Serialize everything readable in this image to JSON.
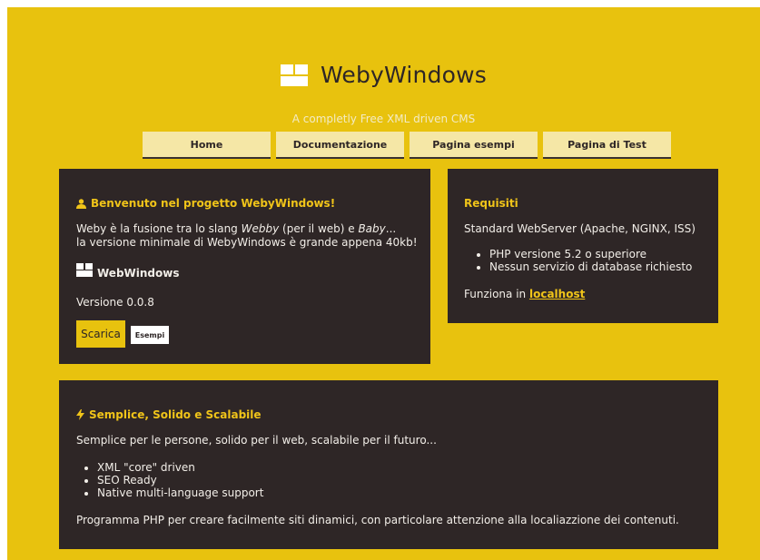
{
  "brand": {
    "title": "WebyWindows",
    "tagline": "A completly Free XML driven CMS"
  },
  "nav": [
    {
      "label": "Home"
    },
    {
      "label": "Documentazione"
    },
    {
      "label": "Pagina esempi"
    },
    {
      "label": "Pagina di Test"
    }
  ],
  "welcome": {
    "title": "Benvenuto nel progetto WebyWindows!",
    "intro_1": "Weby è la fusione tra lo slang ",
    "intro_webby": "Webby",
    "intro_2": " (per il web) e ",
    "intro_baby": "Baby",
    "intro_3": "...",
    "intro_line2": "la versione minimale di WebyWindows è grande appena 40kb!",
    "product": "WebWindows",
    "version": "Versione 0.0.8",
    "download_label": "Scarica",
    "examples_label": "Esempi"
  },
  "requirements": {
    "title": "Requisiti",
    "server": "Standard WebServer (Apache, NGINX, ISS)",
    "items": [
      "PHP versione 5.2 o superiore",
      "Nessun servizio di database richiesto"
    ],
    "runs_in_text": "Funziona in ",
    "runs_in_link": "localhost"
  },
  "features": {
    "title": "Semplice, Solido e Scalabile",
    "intro": "Semplice per le persone, solido per il web, scalabile per il futuro...",
    "items": [
      "XML \"core\" driven",
      "SEO Ready",
      "Native multi-language support"
    ],
    "outro": "Programma PHP per creare facilmente siti dinamici, con particolare attenzione alla localiazzione dei contenuti."
  },
  "colors": {
    "accent": "#e8c20e",
    "panel": "#2e2626",
    "heading": "#f0c419",
    "nav_bg": "#f5e7a6"
  },
  "icons": {
    "logo": "windows-logo-icon",
    "user": "user-icon",
    "bolt": "lightning-icon"
  }
}
